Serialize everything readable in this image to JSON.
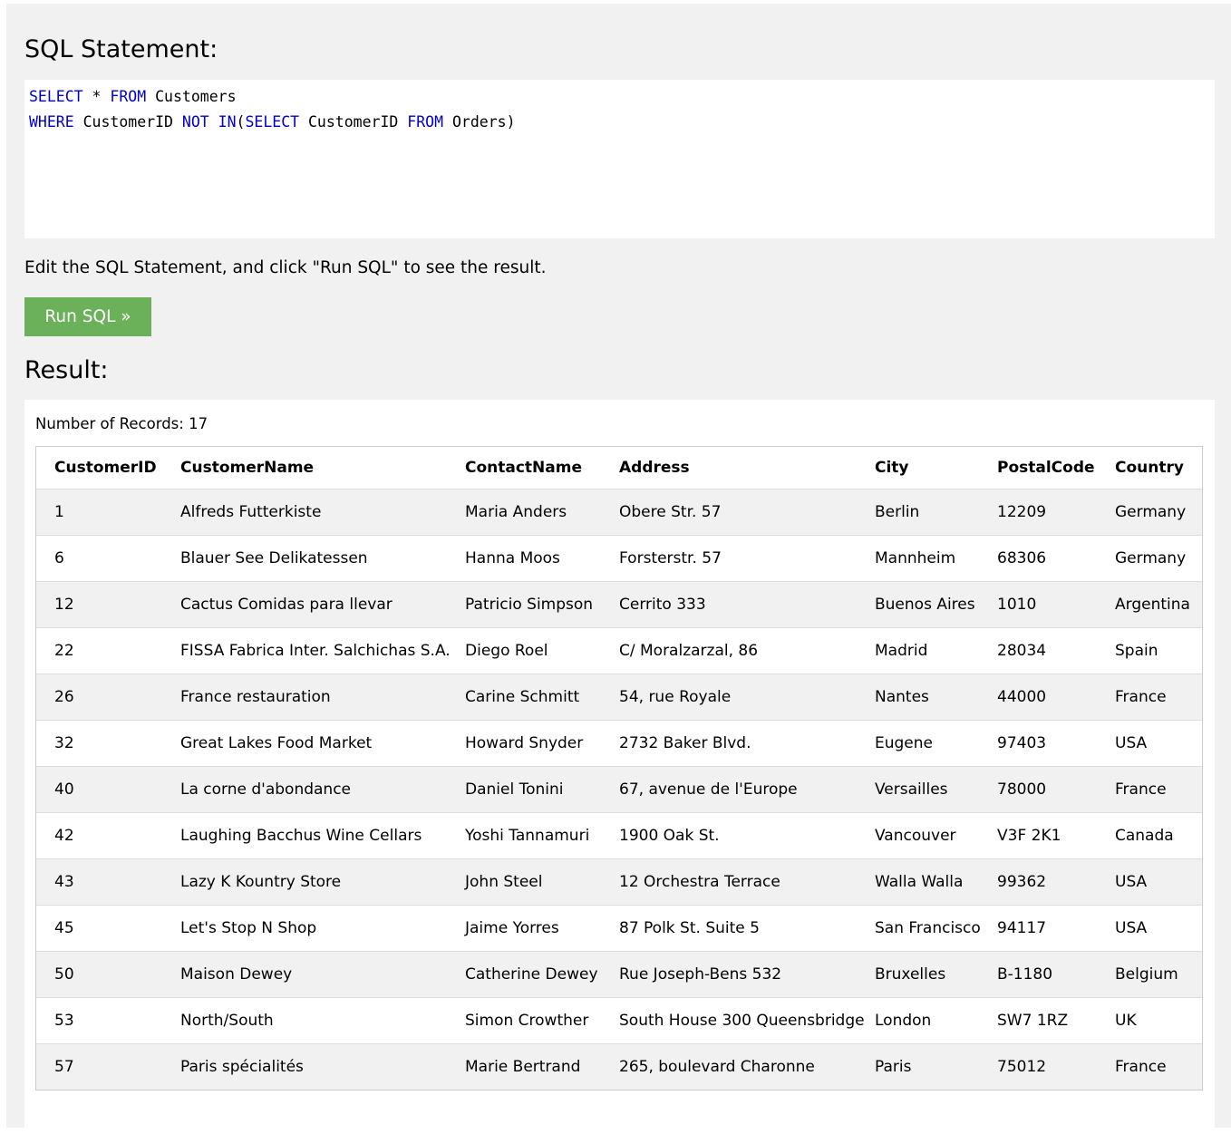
{
  "sql_section": {
    "heading": "SQL Statement:",
    "query_lines": [
      [
        {
          "text": "SELECT",
          "kw": true
        },
        {
          "text": " * ",
          "kw": false
        },
        {
          "text": "FROM",
          "kw": true
        },
        {
          "text": " Customers",
          "kw": false
        }
      ],
      [
        {
          "text": "WHERE",
          "kw": true
        },
        {
          "text": " CustomerID ",
          "kw": false
        },
        {
          "text": "NOT",
          "kw": true
        },
        {
          "text": " ",
          "kw": false
        },
        {
          "text": "IN",
          "kw": true
        },
        {
          "text": "(",
          "kw": false
        },
        {
          "text": "SELECT",
          "kw": true
        },
        {
          "text": " CustomerID ",
          "kw": false
        },
        {
          "text": "FROM",
          "kw": true
        },
        {
          "text": " Orders)",
          "kw": false
        }
      ]
    ],
    "hint": "Edit the SQL Statement, and click \"Run SQL\" to see the result.",
    "run_button_label": "Run SQL »"
  },
  "result_section": {
    "heading": "Result:",
    "records_text": "Number of Records: 17",
    "columns": [
      "CustomerID",
      "CustomerName",
      "ContactName",
      "Address",
      "City",
      "PostalCode",
      "Country"
    ],
    "rows": [
      [
        "1",
        "Alfreds Futterkiste",
        "Maria Anders",
        "Obere Str. 57",
        "Berlin",
        "12209",
        "Germany"
      ],
      [
        "6",
        "Blauer See Delikatessen",
        "Hanna Moos",
        "Forsterstr. 57",
        "Mannheim",
        "68306",
        "Germany"
      ],
      [
        "12",
        "Cactus Comidas para llevar",
        "Patricio Simpson",
        "Cerrito 333",
        "Buenos Aires",
        "1010",
        "Argentina"
      ],
      [
        "22",
        "FISSA Fabrica Inter. Salchichas S.A.",
        "Diego Roel",
        "C/ Moralzarzal, 86",
        "Madrid",
        "28034",
        "Spain"
      ],
      [
        "26",
        "France restauration",
        "Carine Schmitt",
        "54, rue Royale",
        "Nantes",
        "44000",
        "France"
      ],
      [
        "32",
        "Great Lakes Food Market",
        "Howard Snyder",
        "2732 Baker Blvd.",
        "Eugene",
        "97403",
        "USA"
      ],
      [
        "40",
        "La corne d'abondance",
        "Daniel Tonini",
        "67, avenue de l'Europe",
        "Versailles",
        "78000",
        "France"
      ],
      [
        "42",
        "Laughing Bacchus Wine Cellars",
        "Yoshi Tannamuri",
        "1900 Oak St.",
        "Vancouver",
        "V3F 2K1",
        "Canada"
      ],
      [
        "43",
        "Lazy K Kountry Store",
        "John Steel",
        "12 Orchestra Terrace",
        "Walla Walla",
        "99362",
        "USA"
      ],
      [
        "45",
        "Let's Stop N Shop",
        "Jaime Yorres",
        "87 Polk St. Suite 5",
        "San Francisco",
        "94117",
        "USA"
      ],
      [
        "50",
        "Maison Dewey",
        "Catherine Dewey",
        "Rue Joseph-Bens 532",
        "Bruxelles",
        "B-1180",
        "Belgium"
      ],
      [
        "53",
        "North/South",
        "Simon Crowther",
        "South House 300 Queensbridge",
        "London",
        "SW7 1RZ",
        "UK"
      ],
      [
        "57",
        "Paris spécialités",
        "Marie Bertrand",
        "265, boulevard Charonne",
        "Paris",
        "75012",
        "France"
      ]
    ]
  }
}
